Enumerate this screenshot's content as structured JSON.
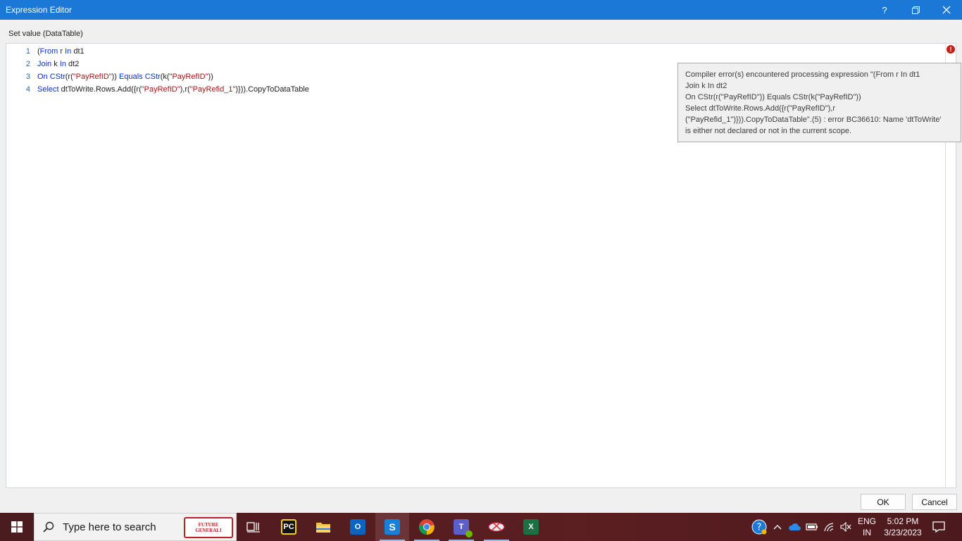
{
  "window": {
    "title": "Expression Editor",
    "help_label": "?",
    "subtitle": "Set value (DataTable)"
  },
  "editor": {
    "lines": [
      {
        "num": "1",
        "tokens": [
          {
            "t": "(",
            "c": "plain"
          },
          {
            "t": "From",
            "c": "kw"
          },
          {
            "t": " r ",
            "c": "plain"
          },
          {
            "t": "In",
            "c": "kw"
          },
          {
            "t": " dt1",
            "c": "plain"
          }
        ]
      },
      {
        "num": "2",
        "tokens": [
          {
            "t": "Join",
            "c": "kw"
          },
          {
            "t": " k ",
            "c": "plain"
          },
          {
            "t": "In",
            "c": "kw"
          },
          {
            "t": " dt2",
            "c": "plain"
          }
        ]
      },
      {
        "num": "3",
        "tokens": [
          {
            "t": "On",
            "c": "kw"
          },
          {
            "t": " ",
            "c": "plain"
          },
          {
            "t": "CStr",
            "c": "kw"
          },
          {
            "t": "(r(",
            "c": "plain"
          },
          {
            "t": "\"PayRefID\"",
            "c": "str"
          },
          {
            "t": ")) ",
            "c": "plain"
          },
          {
            "t": "Equals",
            "c": "kw"
          },
          {
            "t": " ",
            "c": "plain"
          },
          {
            "t": "CStr",
            "c": "kw"
          },
          {
            "t": "(k(",
            "c": "plain"
          },
          {
            "t": "\"PayRefID\"",
            "c": "str"
          },
          {
            "t": "))",
            "c": "plain"
          }
        ]
      },
      {
        "num": "4",
        "tokens": [
          {
            "t": "Select",
            "c": "kw"
          },
          {
            "t": " dtToWrite.Rows.Add({r(",
            "c": "plain"
          },
          {
            "t": "\"PayRefID\"",
            "c": "str"
          },
          {
            "t": "),r(",
            "c": "plain"
          },
          {
            "t": "\"PayRefid_1\"",
            "c": "str"
          },
          {
            "t": ")})).CopyToDataTable",
            "c": "plain"
          }
        ]
      }
    ],
    "error_icon": "!"
  },
  "tooltip": {
    "lines": [
      "Compiler error(s) encountered processing expression \"(From r In dt1",
      "Join k In dt2",
      "On CStr(r(\"PayRefID\")) Equals CStr(k(\"PayRefID\"))",
      "Select dtToWrite.Rows.Add({r(\"PayRefID\"),r",
      "(\"PayRefid_1\")})).CopyToDataTable\".(5) : error BC36610: Name 'dtToWrite'",
      "is either not declared or not in the current scope."
    ]
  },
  "buttons": {
    "ok": "OK",
    "cancel": "Cancel"
  },
  "taskbar": {
    "search_placeholder": "Type here to search",
    "brand_text": "FUTURE GENERALI",
    "apps": [
      {
        "name": "task-view-icon"
      },
      {
        "name": "pycharm-icon",
        "label": "PC",
        "color": "#111111"
      },
      {
        "name": "file-explorer-icon",
        "color": "#f0c24b"
      },
      {
        "name": "outlook-icon",
        "label": "O",
        "color": "#0a64c2"
      },
      {
        "name": "uipath-studio-icon",
        "label": "S",
        "color": "#1a7fd6"
      },
      {
        "name": "chrome-icon"
      },
      {
        "name": "teams-icon",
        "label": "T",
        "color": "#5b5fc7"
      },
      {
        "name": "snipping-tool-icon"
      },
      {
        "name": "excel-icon",
        "label": "X",
        "color": "#1d7044"
      }
    ],
    "language_top": "ENG",
    "language_bottom": "IN",
    "time": "5:02 PM",
    "date": "3/23/2023"
  }
}
